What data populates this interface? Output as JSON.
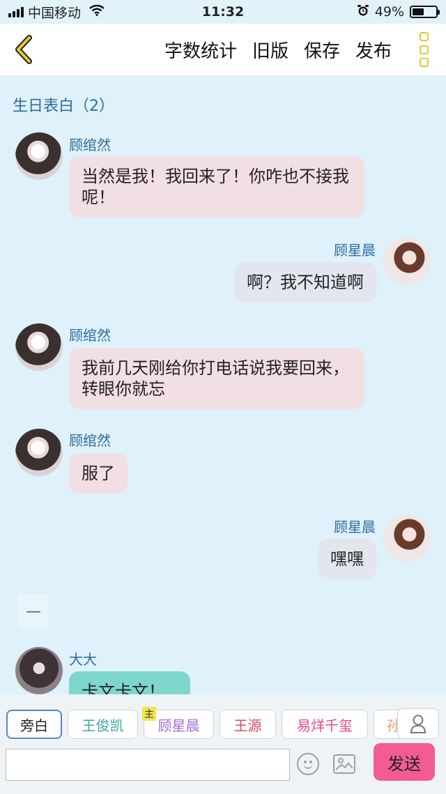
{
  "status_bar": {
    "carrier": "中国移动",
    "time": "11:32",
    "battery_percent": "49%",
    "battery_level": 0.49
  },
  "toolbar": {
    "word_count": "字数统计",
    "old_version": "旧版",
    "save": "保存",
    "publish": "发布"
  },
  "chapter": {
    "title": "生日表白（2）"
  },
  "messages": [
    {
      "side": "left",
      "name": "顾绾然",
      "text": "当然是我！我回来了！你咋也不接我呢！",
      "bubble": "pink"
    },
    {
      "side": "right",
      "name": "顾星晨",
      "text": "啊？我不知道啊",
      "bubble": "grey"
    },
    {
      "side": "left",
      "name": "顾绾然",
      "text": "我前几天刚给你打电话说我要回来，转眼你就忘",
      "bubble": "pink"
    },
    {
      "side": "left",
      "name": "顾绾然",
      "text": "服了",
      "bubble": "pink"
    },
    {
      "side": "right",
      "name": "顾星晨",
      "text": "嘿嘿",
      "bubble": "grey"
    },
    {
      "side": "narration",
      "text": "—"
    },
    {
      "side": "left",
      "name": "大大",
      "text": "卡文卡文！",
      "bubble": "teal"
    }
  ],
  "roles": [
    {
      "label": "旁白",
      "color": "#222222"
    },
    {
      "label": "王俊凯",
      "color": "#3aa6a0"
    },
    {
      "label": "顾星晨",
      "color": "#a36bd6",
      "badge": "主"
    },
    {
      "label": "王源",
      "color": "#e0475d"
    },
    {
      "label": "易烊千玺",
      "color": "#e04a8e"
    },
    {
      "label": "孙",
      "color": "#e8a06a"
    }
  ],
  "input": {
    "placeholder": "",
    "value": ""
  },
  "send_label": "发送",
  "colors": {
    "accent_yellow": "#e2c93a",
    "name_blue": "#2c6c9e",
    "send_pink": "#f25c92",
    "bubble_pink": "#f2dfe4",
    "bubble_grey": "#e3e6ee",
    "bubble_teal": "#7dd7cc"
  }
}
